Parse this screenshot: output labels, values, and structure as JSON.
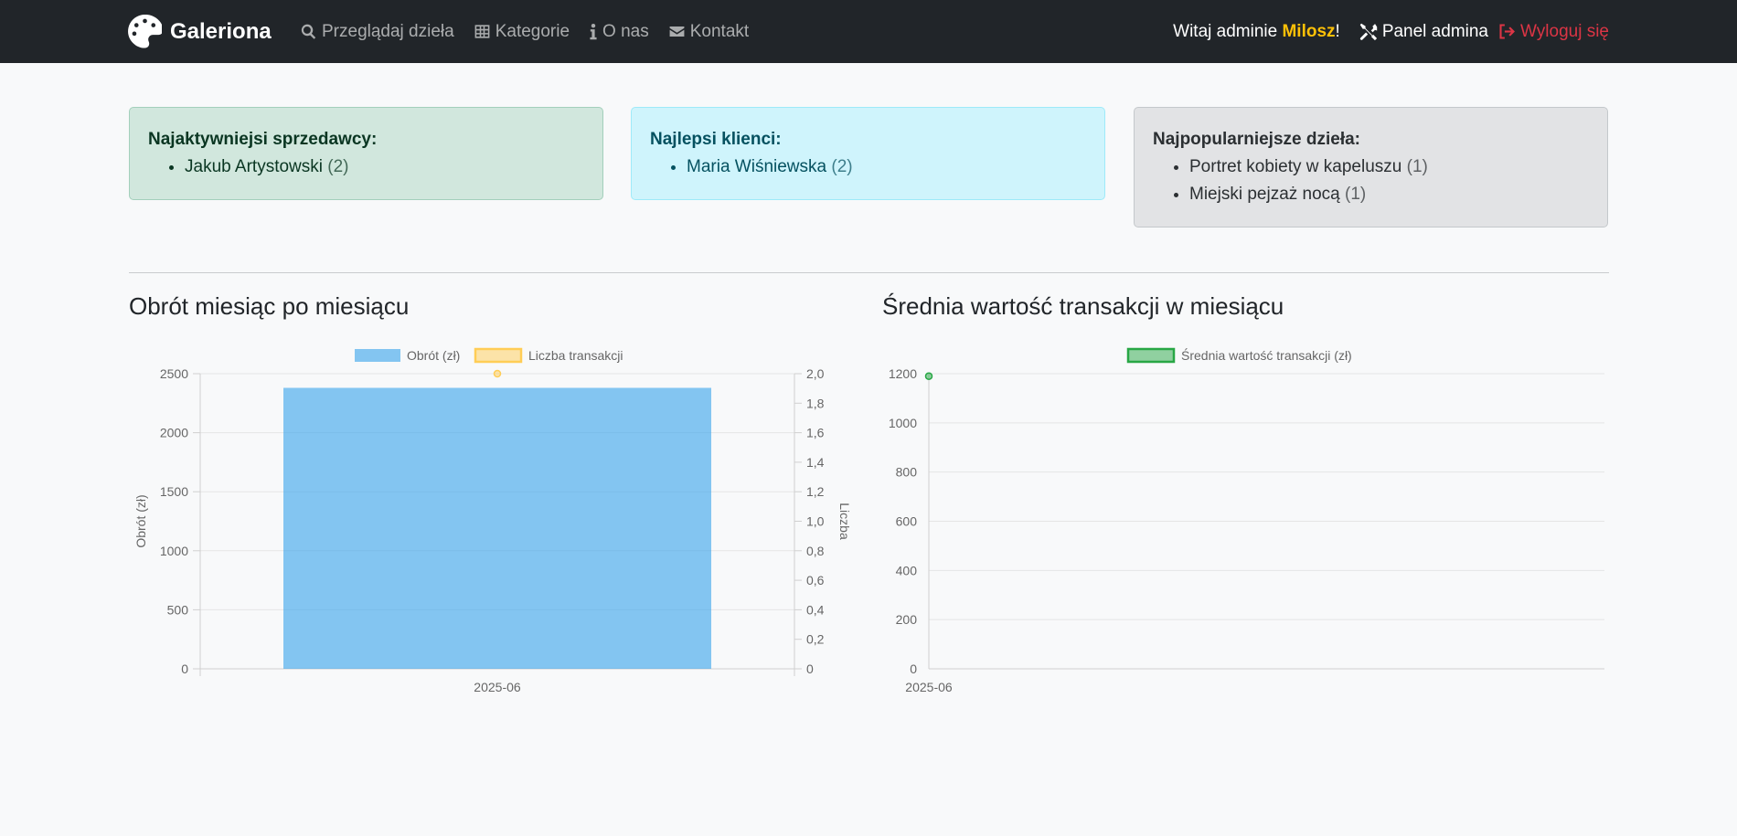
{
  "navbar": {
    "brand": "Galeriona",
    "links": [
      {
        "label": "Przeglądaj dzieła",
        "icon": "search-icon"
      },
      {
        "label": "Kategorie",
        "icon": "grid-icon"
      },
      {
        "label": "O nas",
        "icon": "info-icon"
      },
      {
        "label": "Kontakt",
        "icon": "envelope-icon"
      }
    ],
    "welcome_prefix": "Witaj adminie ",
    "username": "Milosz",
    "welcome_suffix": "!",
    "admin_panel": "Panel admina",
    "logout": "Wyloguj się"
  },
  "cards": {
    "sellers": {
      "title": "Najaktywniejsi sprzedawcy:",
      "items": [
        {
          "name": "Jakub Artystowski",
          "count": "(2)"
        }
      ]
    },
    "clients": {
      "title": "Najlepsi klienci:",
      "items": [
        {
          "name": "Maria Wiśniewska",
          "count": "(2)"
        }
      ]
    },
    "artworks": {
      "title": "Najpopularniejsze dzieła:",
      "items": [
        {
          "name": "Portret kobiety w kapeluszu",
          "count": "(1)"
        },
        {
          "name": "Miejski pejzaż nocą",
          "count": "(1)"
        }
      ]
    }
  },
  "sections": {
    "revenue_title": "Obrót miesiąc po miesiącu",
    "avg_title": "Średnia wartość transakcji w miesiącu"
  },
  "colors": {
    "revenue_bar": "#36a2eb",
    "transactions_line": "#ffcd56",
    "avg_line": "#28a745"
  },
  "chart_data": [
    {
      "type": "bar",
      "categories": [
        "2025-06"
      ],
      "series": [
        {
          "name": "Obrót (zł)",
          "values": [
            2380
          ],
          "axis": "left"
        },
        {
          "name": "Liczba transakcji",
          "values": [
            2
          ],
          "axis": "right",
          "type": "line"
        }
      ],
      "ylabel": "Obrót (zł)",
      "y2label": "Liczba",
      "ylim": [
        0,
        2500
      ],
      "y_ticks": [
        "0",
        "500",
        "1000",
        "1500",
        "2000",
        "2500"
      ],
      "y2lim": [
        0,
        2
      ],
      "y2_ticks": [
        "0",
        "0,2",
        "0,4",
        "0,6",
        "0,8",
        "1,0",
        "1,2",
        "1,4",
        "1,6",
        "1,8",
        "2,0"
      ],
      "legend": "top",
      "grid": true
    },
    {
      "type": "line",
      "categories": [
        "2025-06"
      ],
      "series": [
        {
          "name": "Średnia wartość transakcji (zł)",
          "values": [
            1190
          ]
        }
      ],
      "ylim": [
        0,
        1200
      ],
      "y_ticks": [
        "0",
        "200",
        "400",
        "600",
        "800",
        "1000",
        "1200"
      ],
      "legend": "top",
      "grid": true
    }
  ]
}
